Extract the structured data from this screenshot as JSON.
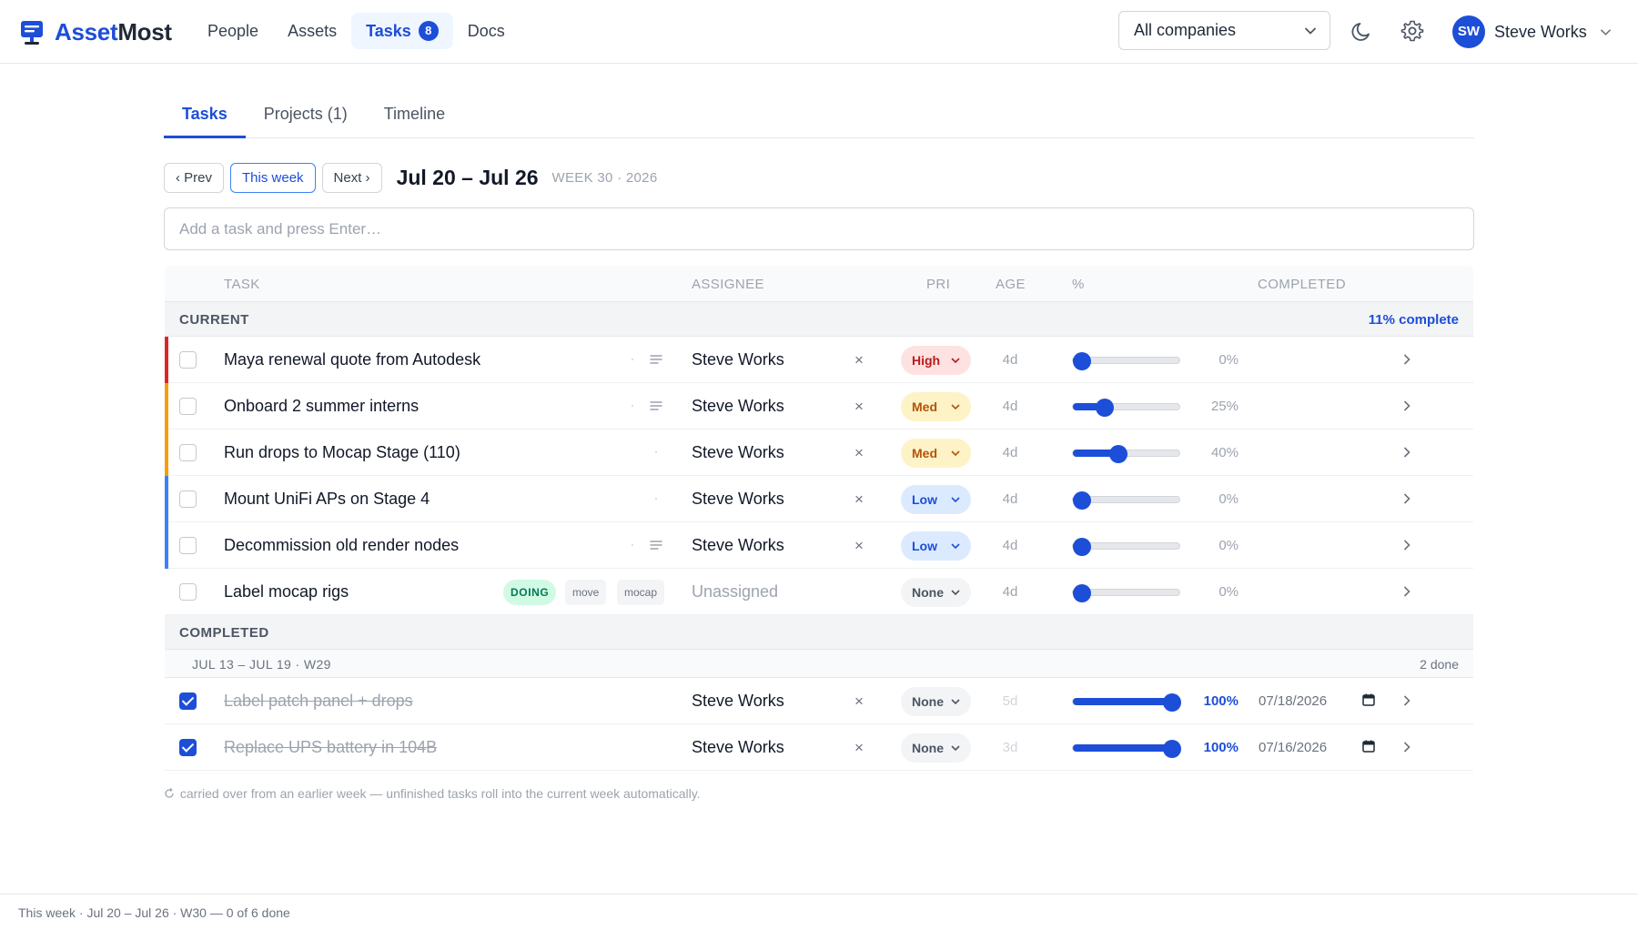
{
  "app": {
    "name_part1": "Asset",
    "name_part2": "Most"
  },
  "nav": {
    "items": [
      {
        "label": "People"
      },
      {
        "label": "Assets"
      },
      {
        "label": "Tasks",
        "badge": "8",
        "active": true
      },
      {
        "label": "Docs"
      }
    ]
  },
  "header": {
    "company_filter": "All companies",
    "user": {
      "initials": "SW",
      "name": "Steve Works"
    }
  },
  "tabs": [
    {
      "label": "Tasks",
      "active": true
    },
    {
      "label": "Projects (1)"
    },
    {
      "label": "Timeline"
    }
  ],
  "week": {
    "prev_label": "‹ Prev",
    "this_week_label": "This week",
    "next_label": "Next ›",
    "range": "Jul 20 – Jul 26",
    "meta": "WEEK 30 · 2026"
  },
  "add_task": {
    "placeholder": "Add a task and press Enter…"
  },
  "table": {
    "columns": {
      "task": "TASK",
      "assignee": "ASSIGNEE",
      "pri": "PRI",
      "age": "AGE",
      "pct": "%",
      "completed": "COMPLETED"
    },
    "current": {
      "title": "CURRENT",
      "summary": "11% complete",
      "rows": [
        {
          "title": "Maya renewal quote from Autodesk",
          "assignee": "Steve Works",
          "priority": "High",
          "age": "4d",
          "progress": 0,
          "progress_label": "0%",
          "color": "#dc2626"
        },
        {
          "title": "Onboard 2 summer interns",
          "assignee": "Steve Works",
          "priority": "Med",
          "age": "4d",
          "progress": 25,
          "progress_label": "25%",
          "color": "#f59e0b"
        },
        {
          "title": "Run drops to Mocap Stage (110)",
          "assignee": "Steve Works",
          "priority": "Med",
          "age": "4d",
          "progress": 40,
          "progress_label": "40%",
          "color": "#f59e0b"
        },
        {
          "title": "Mount UniFi APs on Stage 4",
          "assignee": "Steve Works",
          "priority": "Low",
          "age": "4d",
          "progress": 0,
          "progress_label": "0%",
          "color": "#3b82f6"
        },
        {
          "title": "Decommission old render nodes",
          "assignee": "Steve Works",
          "priority": "Low",
          "age": "4d",
          "progress": 0,
          "progress_label": "0%",
          "color": "#3b82f6"
        },
        {
          "title": "Label mocap rigs",
          "assignee": "Unassigned",
          "priority": "None",
          "age": "4d",
          "progress": 0,
          "progress_label": "0%",
          "status_chip": "DOING",
          "tags": [
            "move",
            "mocap"
          ]
        }
      ]
    },
    "completed": {
      "title": "COMPLETED",
      "group_label": "JUL 13 – JUL 19 · W29",
      "group_count": "2 done",
      "rows": [
        {
          "title": "Label patch panel + drops",
          "assignee": "Steve Works",
          "priority": "None",
          "age": "5d",
          "progress": 100,
          "progress_label": "100%",
          "completed_date": "07/18/2026"
        },
        {
          "title": "Replace UPS battery in 104B",
          "assignee": "Steve Works",
          "priority": "None",
          "age": "3d",
          "progress": 100,
          "progress_label": "100%",
          "completed_date": "07/16/2026"
        }
      ]
    }
  },
  "footnote": "carried over from an earlier week — unfinished tasks roll into the current week automatically.",
  "statusbar": "This week · Jul 20 – Jul 26 · W30 — 0 of 6 done",
  "colors": {
    "accent": "#1d4ed8",
    "high": "#dc2626",
    "med": "#f59e0b",
    "low": "#3b82f6"
  }
}
